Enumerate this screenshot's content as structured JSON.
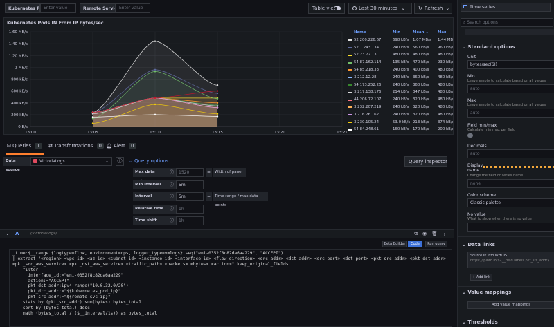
{
  "variables": [
    {
      "label": "Kubernetes Pod IP",
      "placeholder": "Enter value"
    },
    {
      "label": "Remote Service IP",
      "placeholder": "Enter value"
    }
  ],
  "toolbar": {
    "table_view_label": "Table view",
    "time_range": "Last 30 minutes",
    "refresh_label": "Refresh"
  },
  "panel": {
    "title": "Kubernetes Pods IN From IP bytes/sec"
  },
  "chart_data": {
    "type": "line",
    "title": "Kubernetes Pods IN From IP bytes/sec",
    "x": [
      "13:05",
      "13:10",
      "13:15"
    ],
    "x_ticks": [
      "13:00",
      "13:05",
      "13:10",
      "13:15",
      "13:20",
      "13:25"
    ],
    "y_ticks": [
      "0 B/s",
      "200 kB/s",
      "400 kB/s",
      "600 kB/s",
      "800 kB/s",
      "1 MB/s",
      "1.20 MB/s",
      "1.40 MB/s",
      "1.60 MB/s"
    ],
    "ylim": [
      0,
      1600
    ],
    "y_unit": "kB/s",
    "series": [
      {
        "name": "52.200.226.67",
        "color": "#e0e0e0",
        "values": [
          240,
          1440,
          698
        ]
      },
      {
        "name": "52.1.243.134",
        "color": "#5f6a9e",
        "values": [
          240,
          960,
          560
        ]
      },
      {
        "name": "52.23.72.13",
        "color": "#fade2a",
        "values": [
          240,
          480,
          480
        ]
      },
      {
        "name": "54.87.162.114",
        "color": "#73bf69",
        "values": [
          135,
          930,
          470
        ]
      },
      {
        "name": "54.85.218.33",
        "color": "#ff9830",
        "values": [
          240,
          480,
          400
        ]
      },
      {
        "name": "3.212.12.28",
        "color": "#8ab8ff",
        "values": [
          240,
          480,
          360
        ]
      },
      {
        "name": "54.173.252.26",
        "color": "#37872d",
        "values": [
          240,
          480,
          360
        ]
      },
      {
        "name": "3.217.138.176",
        "color": "#d8d9da",
        "values": [
          214,
          480,
          347
        ]
      },
      {
        "name": "44.206.72.107",
        "color": "#ff7383",
        "values": [
          240,
          480,
          320
        ]
      },
      {
        "name": "3.232.207.219",
        "color": "#ffb357",
        "values": [
          240,
          480,
          320
        ]
      },
      {
        "name": "3.216.26.162",
        "color": "#ca95e5",
        "values": [
          240,
          480,
          320
        ]
      },
      {
        "name": "3.230.105.24",
        "color": "#f2cc0c",
        "values": [
          53,
          374,
          213
        ]
      },
      {
        "name": "54.84.248.61",
        "color": "#ffffff",
        "values": [
          160,
          200,
          170
        ]
      },
      {
        "name": "54.172.193.139",
        "color": "#c4162a",
        "values": [
          240,
          480,
          600
        ]
      }
    ]
  },
  "legend": {
    "headers": [
      "Name",
      "Min",
      "Mean ↓",
      "Max"
    ],
    "rows": [
      [
        "52.200.226.67",
        "698 kB/s",
        "1.07 MB/s",
        "1.44 MB/s"
      ],
      [
        "52.1.243.134",
        "240 kB/s",
        "560 kB/s",
        "960 kB/s"
      ],
      [
        "52.23.72.13",
        "480 kB/s",
        "480 kB/s",
        "480 kB/s"
      ],
      [
        "54.87.162.114",
        "135 kB/s",
        "470 kB/s",
        "930 kB/s"
      ],
      [
        "54.85.218.33",
        "240 kB/s",
        "400 kB/s",
        "480 kB/s"
      ],
      [
        "3.212.12.28",
        "240 kB/s",
        "360 kB/s",
        "480 kB/s"
      ],
      [
        "54.173.252.26",
        "240 kB/s",
        "360 kB/s",
        "480 kB/s"
      ],
      [
        "3.217.138.176",
        "214 kB/s",
        "347 kB/s",
        "480 kB/s"
      ],
      [
        "44.206.72.107",
        "240 kB/s",
        "320 kB/s",
        "480 kB/s"
      ],
      [
        "3.232.207.219",
        "240 kB/s",
        "320 kB/s",
        "480 kB/s"
      ],
      [
        "3.216.26.162",
        "240 kB/s",
        "320 kB/s",
        "480 kB/s"
      ],
      [
        "3.230.105.24",
        "53.0 kB/s",
        "213 kB/s",
        "374 kB/s"
      ],
      [
        "54.84.248.61",
        "160 kB/s",
        "170 kB/s",
        "200 kB/s"
      ],
      [
        "54.172.193.139",
        "600 kB/s",
        "960 kB/s",
        "480 kB/s"
      ]
    ]
  },
  "tabs": [
    {
      "label": "Queries",
      "count": "1"
    },
    {
      "label": "Transformations",
      "count": "0"
    },
    {
      "label": "Alert",
      "count": "0"
    }
  ],
  "datasource": {
    "label": "Data source",
    "value": "VictoriaLogs"
  },
  "query_options": {
    "title": "Query options",
    "inspector": "Query inspector",
    "rows": [
      {
        "label": "Max data points",
        "value": "1520",
        "note": "Width of panel"
      },
      {
        "label": "Min interval",
        "value": "5m",
        "note": ""
      },
      {
        "label": "Interval",
        "value": "5m",
        "note": "Time range / max data points"
      },
      {
        "label": "Relative time",
        "value": "1h",
        "note": ""
      },
      {
        "label": "Time shift",
        "value": "1h",
        "note": ""
      }
    ]
  },
  "query": {
    "ref": "A",
    "ds": "(VictoriaLogs)",
    "builder": "Beta Builder",
    "code": "Code",
    "run": "Run query",
    "lines": [
      "_time:$__range {logtype=flow, environment=ops, logger_type=vmlogs} seq(\"eni-0352f8c82da6aa229\", \"ACCEPT\")",
      "| extract \"<region> <vpc_id> <az_id> <subnet_id> <instance_id> <interface_id> <flow_direction> <src_addr> <dst_addr> <src_port> <dst_port> <pkt_src_addr> <pkt_dst_addr>",
      "<pkt_src_aws_service> <pkt_dst_aws_service> <traffic_path> <packets> <bytes> <action>\" keep_original_fields",
      "  | filter",
      "      interface_id:=\"eni-0352f8c82da6aa229\"",
      "      action:=\"ACCEPT\"",
      "      pkt_dst_addr:ipv4_range(\"10.0.32.0/20\")",
      "      pkt_drc_addr:=\"${kubernetes_pod_ip}\"",
      "      pkt_src_addr:=\"${remote_svc_ip}\"",
      "  | stats by (pkt_src_addr) sum(bytes) bytes_total",
      "  | sort by (bytes_total) desc",
      "  | math (bytes_total / ($__interval/1s)) as bytes_total"
    ]
  },
  "options_pane": {
    "viz": "Time series",
    "search_placeholder": "Search options",
    "standard_title": "Standard options",
    "unit_label": "Unit",
    "unit_value": "bytes/sec(SI)",
    "min_label": "Min",
    "min_desc": "Leave empty to calculate based on all values",
    "min_value": "auto",
    "max_label": "Max",
    "max_desc": "Leave empty to calculate based on all values",
    "max_value": "auto",
    "fieldminmax_label": "Field min/max",
    "fieldminmax_desc": "Calculate min max per field",
    "decimals_label": "Decimals",
    "decimals_value": "auto",
    "display_label": "Display name",
    "display_desc": "Change the field or series name",
    "display_value": "none",
    "color_label": "Color scheme",
    "color_value": "Classic palette",
    "novalue_label": "No value",
    "novalue_desc": "What to show when there is no value",
    "novalue_value": "-",
    "datalinks_title": "Data links",
    "datalink_title": "Source IP info WHOIS",
    "datalink_url": "https://ipinfo.io/${__field.labels.pkt_src_addr}",
    "add_link": "+ Add link",
    "mappings_title": "Value mappings",
    "add_mappings": "Add value mappings",
    "thresholds_title": "Thresholds"
  }
}
